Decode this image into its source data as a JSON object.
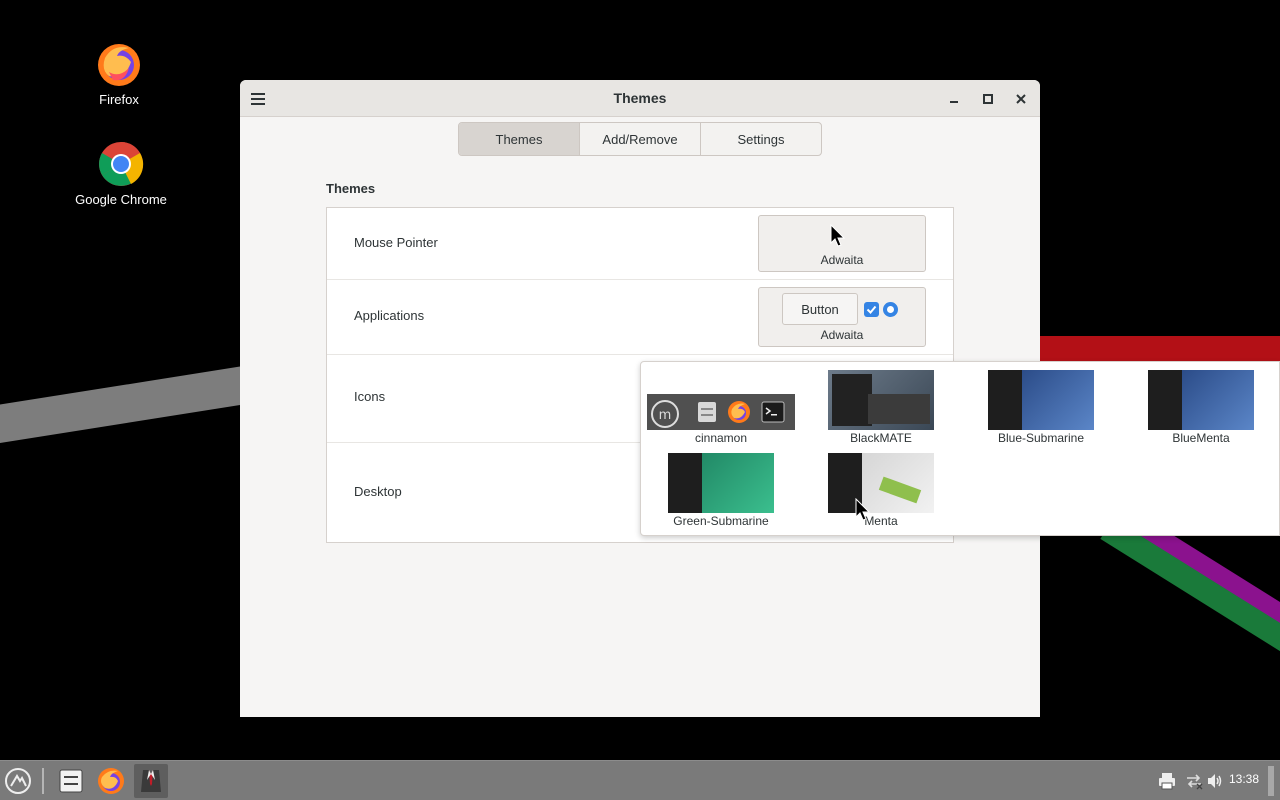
{
  "desktop": {
    "icons": [
      {
        "label": "Firefox",
        "icon": "firefox-icon"
      },
      {
        "label": "Google Chrome",
        "icon": "chrome-icon"
      }
    ]
  },
  "window": {
    "title": "Themes",
    "tabs": [
      {
        "label": "Themes",
        "active": true
      },
      {
        "label": "Add/Remove",
        "active": false
      },
      {
        "label": "Settings",
        "active": false
      }
    ],
    "section_title": "Themes",
    "rows": [
      {
        "label": "Mouse Pointer",
        "value": "Adwaita"
      },
      {
        "label": "Applications",
        "value": "Adwaita",
        "sample_button": "Button"
      },
      {
        "label": "Icons"
      },
      {
        "label": "Desktop"
      }
    ]
  },
  "icon_popover": {
    "themes": [
      {
        "name": "cinnamon"
      },
      {
        "name": "BlackMATE"
      },
      {
        "name": "Blue-Submarine"
      },
      {
        "name": "BlueMenta"
      },
      {
        "name": "Green-Submarine"
      },
      {
        "name": "Menta"
      }
    ]
  },
  "taskbar": {
    "clock": "13:38",
    "launchers": [
      "mint-menu-icon",
      "file-manager-icon",
      "firefox-icon",
      "themes-app-icon"
    ],
    "tray": [
      "printer-icon",
      "network-icon",
      "volume-icon"
    ]
  },
  "colors": {
    "accent": "#3584e4",
    "window_bg": "#f6f5f4",
    "taskbar_bg": "#7a7a7a"
  }
}
